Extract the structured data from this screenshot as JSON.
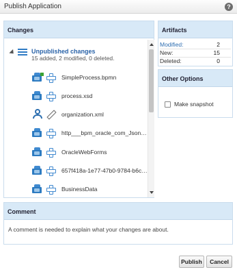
{
  "dialog": {
    "title": "Publish Application",
    "help_icon": "help-icon",
    "help_glyph": "?"
  },
  "changes": {
    "header": "Changes",
    "root": {
      "title": "Unpublished changes",
      "summary": "15 added, 2 modified, 0 deleted."
    },
    "items": [
      {
        "label": "SimpleProcess.bpmn",
        "icon": "process-artifact-icon",
        "action": "modified-icon"
      },
      {
        "label": "process.xsd",
        "icon": "artifact-icon",
        "action": "added-icon"
      },
      {
        "label": "organization.xml",
        "icon": "organization-icon",
        "action": "edited-icon"
      },
      {
        "label": "http___bpm_oracle_com_JsonB...",
        "icon": "artifact-icon",
        "action": "added-icon"
      },
      {
        "label": "OracleWebForms",
        "icon": "artifact-icon",
        "action": "added-icon"
      },
      {
        "label": "657f418a-1e77-47b0-9784-b6cb...",
        "icon": "artifact-icon",
        "action": "added-icon"
      },
      {
        "label": "BusinessData",
        "icon": "artifact-icon",
        "action": "added-icon"
      }
    ]
  },
  "artifacts": {
    "header": "Artifacts",
    "stats": [
      {
        "label": "Modified:",
        "value": "2"
      },
      {
        "label": "New:",
        "value": "15"
      },
      {
        "label": "Deleted:",
        "value": "0"
      }
    ],
    "label_colors": [
      "#2b6cb0",
      "#333333",
      "#333333"
    ]
  },
  "options": {
    "header": "Other Options",
    "snapshot_label": "Make snapshot",
    "snapshot_checked": false
  },
  "comment": {
    "header": "Comment",
    "placeholder": "A comment is needed to explain what your changes are about."
  },
  "buttons": {
    "publish": "Publish",
    "cancel": "Cancel"
  },
  "colors": {
    "panel_header_bg": "#d8e9f7",
    "panel_border": "#c9dced",
    "accent_blue": "#2d7bc1",
    "link_blue": "#2a63a8"
  }
}
